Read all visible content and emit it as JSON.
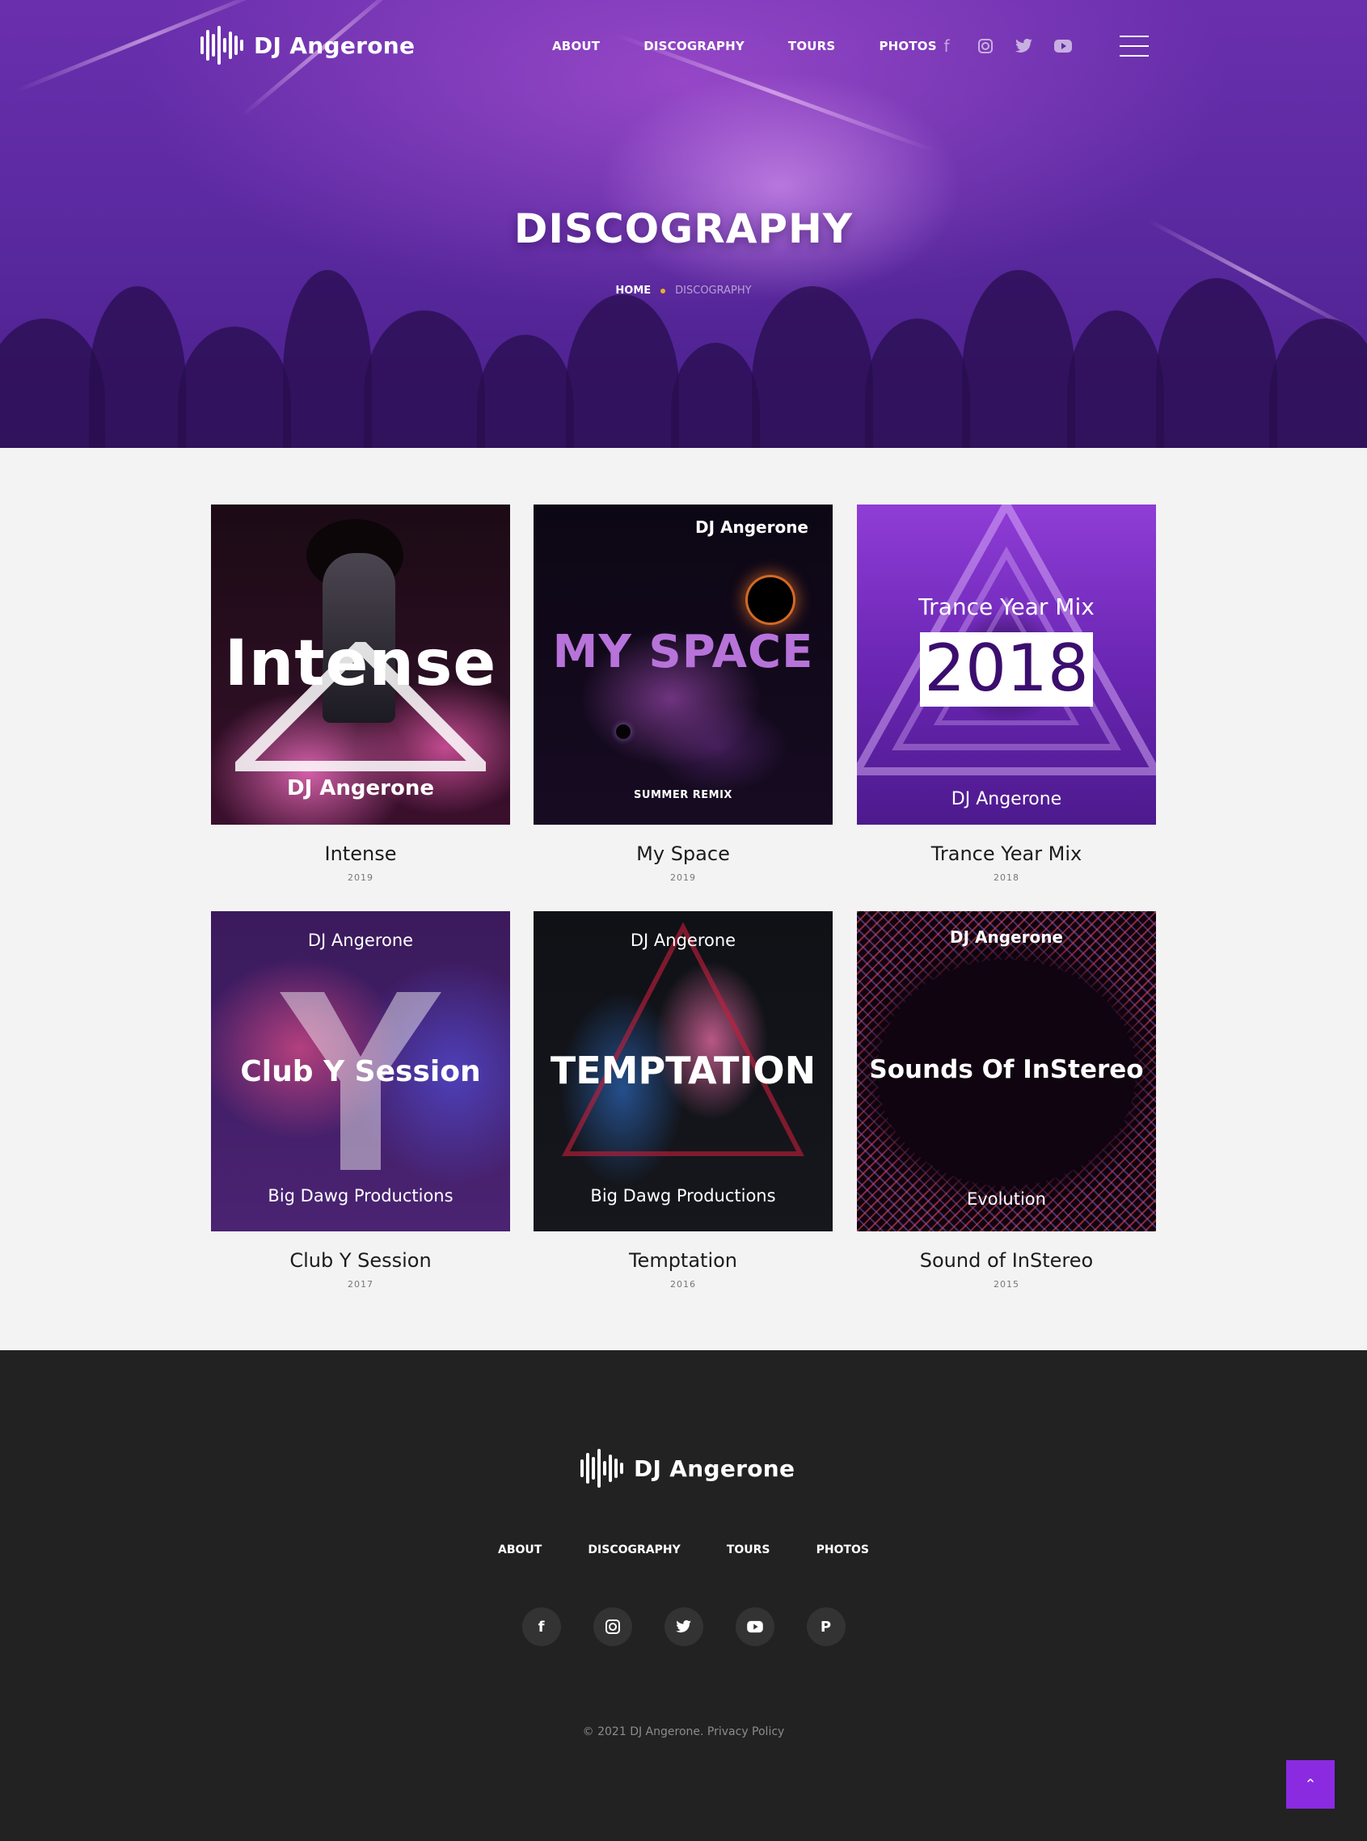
{
  "brand": {
    "name": "DJ Angerone"
  },
  "header": {
    "nav": [
      "ABOUT",
      "DISCOGRAPHY",
      "TOURS",
      "PHOTOS"
    ],
    "socials": [
      "facebook-icon",
      "instagram-icon",
      "twitter-icon",
      "youtube-icon"
    ],
    "menu_icon": "hamburger-icon"
  },
  "hero": {
    "title": "DISCOGRAPHY",
    "breadcrumb": {
      "home": "HOME",
      "current": "DISCOGRAPHY"
    }
  },
  "albums": [
    {
      "title": "Intense",
      "year": "2019",
      "cover": {
        "main": "Intense",
        "artist": "DJ Angerone"
      }
    },
    {
      "title": "My Space",
      "year": "2019",
      "cover": {
        "artist": "DJ Angerone",
        "main": "MY SPACE",
        "sub": "SUMMER REMIX"
      }
    },
    {
      "title": "Trance Year Mix",
      "year": "2018",
      "cover": {
        "top": "Trance Year Mix",
        "main": "2018",
        "artist": "DJ Angerone"
      }
    },
    {
      "title": "Club Y Session",
      "year": "2017",
      "cover": {
        "artist": "DJ Angerone",
        "main": "Club Y Session",
        "sub": "Big Dawg Productions"
      }
    },
    {
      "title": "Temptation",
      "year": "2016",
      "cover": {
        "artist": "DJ Angerone",
        "main": "TEMPTATION",
        "sub": "Big Dawg Productions"
      }
    },
    {
      "title": "Sound of InStereo",
      "year": "2015",
      "cover": {
        "artist": "DJ Angerone",
        "main": "Sounds Of InStereo",
        "sub": "Evolution"
      }
    }
  ],
  "footer": {
    "brand": "DJ Angerone",
    "nav": [
      "ABOUT",
      "DISCOGRAPHY",
      "TOURS",
      "PHOTOS"
    ],
    "socials": [
      "facebook-icon",
      "instagram-icon",
      "twitter-icon",
      "youtube-icon",
      "pinterest-icon"
    ],
    "copyright": "©  2021 DJ Angerone. Privacy Policy"
  },
  "colors": {
    "accent": "#8a2be2",
    "hero": "#5c2aa2",
    "footer": "#222222",
    "breadcrumb_dot": "#e3b423"
  }
}
